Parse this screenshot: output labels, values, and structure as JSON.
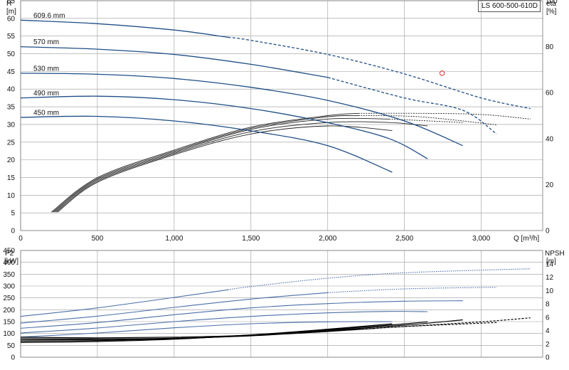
{
  "model_label": "LS 600-500-610D",
  "colors": {
    "head": "#1f4e87",
    "power": "#4a6fa8",
    "eff": "#222222",
    "npsh": "#000000",
    "marker": "#e03030",
    "grid": "#9a9a9a"
  },
  "chart_data": [
    {
      "type": "line",
      "panel": "top",
      "xlabel": "Q [m³/h]",
      "x_ticks": [
        "0",
        "500",
        "1,000",
        "1,500",
        "2,000",
        "2,500",
        "3,000"
      ],
      "xlim": [
        0,
        3400
      ],
      "left_axis": {
        "label_top": "H",
        "label_unit": "[m]",
        "ylim": [
          0,
          65
        ],
        "ticks": [
          "0",
          "5",
          "10",
          "15",
          "20",
          "25",
          "30",
          "35",
          "40",
          "45",
          "50",
          "55",
          "60",
          "65"
        ]
      },
      "right_axis": {
        "label_top": "eta",
        "label_unit": "[%]",
        "ylim": [
          0,
          100
        ],
        "ticks": [
          "0",
          "20",
          "40",
          "60",
          "80",
          "100"
        ]
      },
      "head_series": [
        {
          "name": "609.6 mm",
          "solid_to": 1350,
          "points": [
            [
              0,
              59.5
            ],
            [
              500,
              58.5
            ],
            [
              1000,
              56.7
            ],
            [
              1500,
              53.8
            ],
            [
              2000,
              49.8
            ],
            [
              2500,
              44.3
            ],
            [
              3000,
              37.5
            ],
            [
              3320,
              34.5
            ]
          ]
        },
        {
          "name": "570 mm",
          "solid_to": 2000,
          "points": [
            [
              0,
              52.0
            ],
            [
              500,
              51.3
            ],
            [
              1000,
              49.8
            ],
            [
              1500,
              47.0
            ],
            [
              2000,
              43.3
            ],
            [
              2500,
              37.5
            ],
            [
              2880,
              34.0
            ],
            [
              3100,
              27.3
            ]
          ]
        },
        {
          "name": "530 mm",
          "solid_to": 2880,
          "points": [
            [
              0,
              44.5
            ],
            [
              500,
              44.2
            ],
            [
              1000,
              43.0
            ],
            [
              1500,
              40.5
            ],
            [
              2000,
              36.8
            ],
            [
              2500,
              31.0
            ],
            [
              2880,
              24.0
            ]
          ]
        },
        {
          "name": "490 mm",
          "solid_to": 2650,
          "points": [
            [
              0,
              37.5
            ],
            [
              500,
              38.0
            ],
            [
              1000,
              37.0
            ],
            [
              1500,
              34.5
            ],
            [
              2000,
              30.5
            ],
            [
              2400,
              26.0
            ],
            [
              2650,
              20.3
            ]
          ]
        },
        {
          "name": "450 mm",
          "solid_to": 2420,
          "points": [
            [
              0,
              32.0
            ],
            [
              500,
              32.3
            ],
            [
              1000,
              31.0
            ],
            [
              1500,
              28.2
            ],
            [
              2000,
              24.0
            ],
            [
              2420,
              16.5
            ]
          ]
        }
      ],
      "eff_series": [
        {
          "solid_to": 2200,
          "points": [
            [
              200,
              8
            ],
            [
              500,
              23
            ],
            [
              1000,
              35
            ],
            [
              1500,
              45
            ],
            [
              2000,
              50
            ],
            [
              2200,
              51
            ],
            [
              2600,
              51
            ],
            [
              3000,
              50.5
            ],
            [
              3320,
              48.5
            ]
          ]
        },
        {
          "solid_to": 2200,
          "points": [
            [
              210,
              8
            ],
            [
              500,
              22.5
            ],
            [
              1000,
              34.5
            ],
            [
              1500,
              44.5
            ],
            [
              2000,
              49.5
            ],
            [
              2200,
              50
            ],
            [
              2600,
              49.5
            ],
            [
              3100,
              46
            ]
          ]
        },
        {
          "solid_to": 2400,
          "points": [
            [
              220,
              8
            ],
            [
              500,
              22
            ],
            [
              1000,
              34
            ],
            [
              1500,
              44
            ],
            [
              2000,
              48.5
            ],
            [
              2400,
              48.5
            ],
            [
              2880,
              47
            ]
          ]
        },
        {
          "solid_to": 2650,
          "points": [
            [
              230,
              8
            ],
            [
              500,
              21.5
            ],
            [
              1000,
              33.5
            ],
            [
              1500,
              43
            ],
            [
              2000,
              47
            ],
            [
              2400,
              47
            ],
            [
              2650,
              45.5
            ]
          ]
        },
        {
          "solid_to": 2420,
          "points": [
            [
              240,
              8
            ],
            [
              500,
              21
            ],
            [
              1000,
              33
            ],
            [
              1500,
              42
            ],
            [
              2000,
              45.5
            ],
            [
              2420,
              43.5
            ]
          ]
        }
      ],
      "marker": {
        "x": 2745,
        "y": 44.5
      }
    },
    {
      "type": "line",
      "panel": "bottom",
      "xlim": [
        0,
        3400
      ],
      "left_axis": {
        "label_top": "P2",
        "label_unit": "[kW]",
        "ylim": [
          0,
          450
        ],
        "ticks": [
          "0",
          "50",
          "100",
          "150",
          "200",
          "250",
          "300",
          "350",
          "400",
          "450"
        ]
      },
      "right_axis": {
        "label_top": "NPSH",
        "label_unit": "[m]",
        "ylim": [
          0,
          16
        ],
        "ticks": [
          "0",
          "2",
          "4",
          "6",
          "8",
          "10",
          "12",
          "14"
        ]
      },
      "power_series": [
        {
          "solid_to": 1350,
          "points": [
            [
              0,
              172
            ],
            [
              500,
              208
            ],
            [
              1000,
              252
            ],
            [
              1500,
              298
            ],
            [
              2000,
              333
            ],
            [
              2500,
              356
            ],
            [
              3320,
              373
            ]
          ]
        },
        {
          "solid_to": 2000,
          "points": [
            [
              0,
              144
            ],
            [
              500,
              173
            ],
            [
              1000,
              210
            ],
            [
              1500,
              245
            ],
            [
              2000,
              272
            ],
            [
              2500,
              288
            ],
            [
              3100,
              295
            ]
          ]
        },
        {
          "solid_to": 2880,
          "points": [
            [
              0,
              122
            ],
            [
              500,
              146
            ],
            [
              1000,
              179
            ],
            [
              1500,
              208
            ],
            [
              2000,
              226
            ],
            [
              2500,
              236
            ],
            [
              2880,
              238
            ]
          ]
        },
        {
          "solid_to": 2650,
          "points": [
            [
              0,
              102
            ],
            [
              500,
              123
            ],
            [
              1000,
              150
            ],
            [
              1500,
              172
            ],
            [
              2000,
              187
            ],
            [
              2400,
              193
            ],
            [
              2650,
              192
            ]
          ]
        },
        {
          "solid_to": 2420,
          "points": [
            [
              0,
              85
            ],
            [
              500,
              102
            ],
            [
              1000,
              124
            ],
            [
              1500,
              141
            ],
            [
              2000,
              149
            ],
            [
              2420,
              150
            ]
          ]
        }
      ],
      "npsh_series": [
        {
          "solid_to": 2200,
          "points": [
            [
              0,
              3.0
            ],
            [
              500,
              2.9
            ],
            [
              1000,
              3.0
            ],
            [
              1500,
              3.3
            ],
            [
              2000,
              3.9
            ],
            [
              2500,
              4.6
            ],
            [
              3000,
              5.3
            ],
            [
              3320,
              5.9
            ]
          ]
        },
        {
          "solid_to": 2300,
          "points": [
            [
              0,
              2.8
            ],
            [
              500,
              2.75
            ],
            [
              1000,
              2.85
            ],
            [
              1500,
              3.2
            ],
            [
              2000,
              3.85
            ],
            [
              2500,
              4.6
            ],
            [
              3100,
              5.2
            ]
          ]
        },
        {
          "solid_to": 2880,
          "points": [
            [
              0,
              2.6
            ],
            [
              500,
              2.65
            ],
            [
              1000,
              2.8
            ],
            [
              1500,
              3.25
            ],
            [
              2000,
              4.0
            ],
            [
              2500,
              4.8
            ],
            [
              2880,
              5.6
            ]
          ]
        },
        {
          "solid_to": 2650,
          "points": [
            [
              0,
              2.4
            ],
            [
              500,
              2.5
            ],
            [
              1000,
              2.75
            ],
            [
              1500,
              3.3
            ],
            [
              2000,
              4.1
            ],
            [
              2400,
              4.8
            ],
            [
              2650,
              5.3
            ]
          ]
        },
        {
          "solid_to": 2420,
          "points": [
            [
              0,
              2.2
            ],
            [
              500,
              2.35
            ],
            [
              1000,
              2.7
            ],
            [
              1500,
              3.35
            ],
            [
              2000,
              4.2
            ],
            [
              2420,
              5.0
            ]
          ]
        }
      ]
    }
  ]
}
